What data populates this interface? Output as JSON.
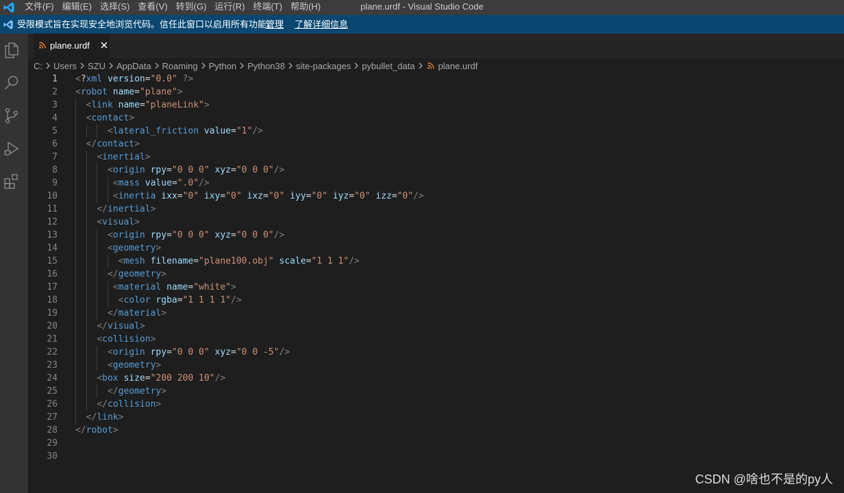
{
  "window": {
    "title": "plane.urdf - Visual Studio Code",
    "menu": [
      "文件(F)",
      "编辑(E)",
      "选择(S)",
      "查看(V)",
      "转到(G)",
      "运行(R)",
      "终端(T)",
      "帮助(H)"
    ]
  },
  "banner": {
    "text": "受限模式旨在实现安全地浏览代码。信任此窗口以启用所有功能。",
    "manage_link": "管理",
    "learn_more_link": "了解详细信息"
  },
  "activitybar": {
    "items": [
      "explorer-icon",
      "search-icon",
      "source-control-icon",
      "run-debug-icon",
      "extensions-icon"
    ]
  },
  "tab": {
    "label": "plane.urdf"
  },
  "breadcrumb": [
    "C:",
    "Users",
    "SZU",
    "AppData",
    "Roaming",
    "Python",
    "Python38",
    "site-packages",
    "pybullet_data",
    "plane.urdf"
  ],
  "editor": {
    "active_line": 1,
    "lines": [
      "<?xml version=\"0.0\" ?>",
      "<robot name=\"plane\">",
      "  <link name=\"planeLink\">",
      "  <contact>",
      "      <lateral_friction value=\"1\"/>",
      "  </contact>",
      "    <inertial>",
      "      <origin rpy=\"0 0 0\" xyz=\"0 0 0\"/>",
      "       <mass value=\".0\"/>",
      "       <inertia ixx=\"0\" ixy=\"0\" ixz=\"0\" iyy=\"0\" iyz=\"0\" izz=\"0\"/>",
      "    </inertial>",
      "    <visual>",
      "      <origin rpy=\"0 0 0\" xyz=\"0 0 0\"/>",
      "      <geometry>",
      "        <mesh filename=\"plane100.obj\" scale=\"1 1 1\"/>",
      "      </geometry>",
      "       <material name=\"white\">",
      "        <color rgba=\"1 1 1 1\"/>",
      "      </material>",
      "    </visual>",
      "    <collision>",
      "      <origin rpy=\"0 0 0\" xyz=\"0 0 -5\"/>",
      "      <geometry>",
      "    <box size=\"200 200 10\"/>",
      "      </geometry>",
      "    </collision>",
      "  </link>",
      "</robot>",
      "",
      ""
    ]
  },
  "watermark": "CSDN @啥也不是的py人",
  "colors": {
    "titlebar": "#3c3c3c",
    "banner": "#094771",
    "activitybar": "#333333",
    "editor_bg": "#1e1e1e",
    "tag": "#569cd6",
    "attr": "#9cdcfe",
    "string": "#ce9178",
    "file_icon": "#e37933"
  }
}
